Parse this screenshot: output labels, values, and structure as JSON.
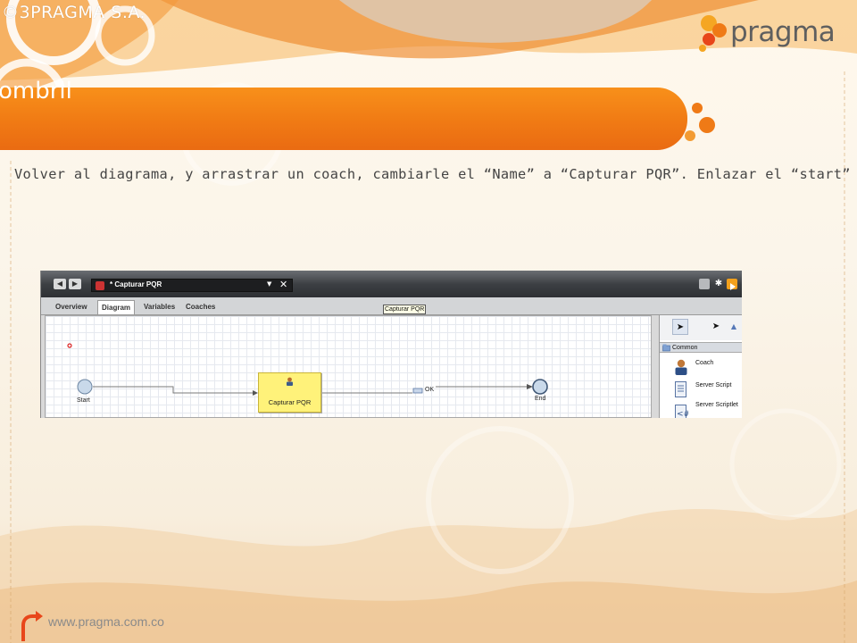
{
  "slide": {
    "copyright": "©3PRAGMA S.A.",
    "logo_text": "pragma",
    "banner_title": "ombril",
    "instruction": "Volver al diagrama, y arrastrar un coach, cambiarle el “Name” a “Capturar PQR”.  Enlazar el “start”",
    "footer_url": "www.pragma.com.co"
  },
  "colors": {
    "brand_orange": "#f07a14",
    "banner_gradient_top": "#f8901a",
    "coach_fill": "#fff27a"
  },
  "screenshot": {
    "editor_tab": {
      "label": "* Capturar PQR",
      "dropdown_icon": "chevron-down-icon",
      "close_symbol": "✕"
    },
    "nav": {
      "back_symbol": "◀",
      "forward_symbol": "▶"
    },
    "view_tabs": [
      {
        "label": "Overview",
        "active": false
      },
      {
        "label": "Diagram",
        "active": true
      },
      {
        "label": "Variables",
        "active": false
      },
      {
        "label": "Coaches",
        "active": false
      }
    ],
    "tooltip": "Capturar PQR",
    "diagram": {
      "start_label": "Start",
      "coach_label": "Capturar PQR",
      "flow_label": "OK",
      "end_label": "End"
    },
    "palette": {
      "section": "Common",
      "items": [
        {
          "label": "Coach",
          "icon": "coach-icon"
        },
        {
          "label": "Server Script",
          "icon": "server-script-icon"
        },
        {
          "label": "Server Scriptlet",
          "icon": "server-scriptlet-icon"
        }
      ]
    }
  }
}
